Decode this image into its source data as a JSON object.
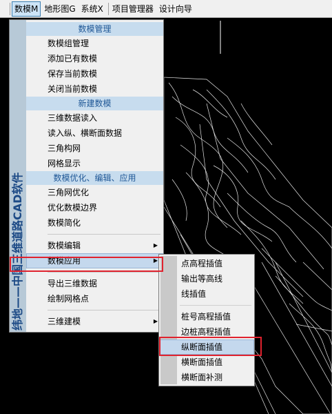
{
  "menubar": {
    "items": [
      {
        "label": "数模M",
        "active": true
      },
      {
        "label": "地形图G",
        "active": false
      },
      {
        "label": "系统X",
        "active": false
      },
      {
        "label": "项目管理器",
        "active": false
      },
      {
        "label": "设计向导",
        "active": false
      }
    ]
  },
  "dropdown": {
    "banner": "纬地——中国三维道路CAD软件",
    "sections": [
      {
        "header": "数模管理",
        "items": [
          "数模组管理",
          "添加已有数模",
          "保存当前数模",
          "关闭当前数模"
        ]
      },
      {
        "header": "新建数模",
        "items": [
          "三维数据读入",
          "读入纵、横断面数据",
          "三角构网",
          "网格显示"
        ]
      },
      {
        "header": "数模优化、编辑、应用",
        "items": [
          "三角网优化",
          "优化数模边界",
          "数模简化"
        ]
      }
    ],
    "group_edit": {
      "label": "数模编辑",
      "has_submenu": true
    },
    "group_apply": {
      "label": "数模应用",
      "has_submenu": true,
      "highlighted": true
    },
    "group_export": [
      "导出三维数据",
      "绘制网格点"
    ],
    "group_build": {
      "label": "三维建模",
      "has_submenu": true
    }
  },
  "submenu": {
    "group1": [
      "点高程插值",
      "输出等高线",
      "线插值"
    ],
    "group2": [
      "桩号高程插值",
      "边桩高程插值",
      "纵断面插值",
      "横断面插值",
      "横断面补测"
    ],
    "highlighted": "纵断面插值"
  },
  "colors": {
    "menu_bg": "#f0f0f0",
    "header_bg": "#c7dcee",
    "header_text": "#1f5796",
    "highlight": "#c4d8ed",
    "annotation_red": "#e0222e",
    "banner_bg": "#b7c9d7",
    "banner_text": "#1c4a86"
  }
}
